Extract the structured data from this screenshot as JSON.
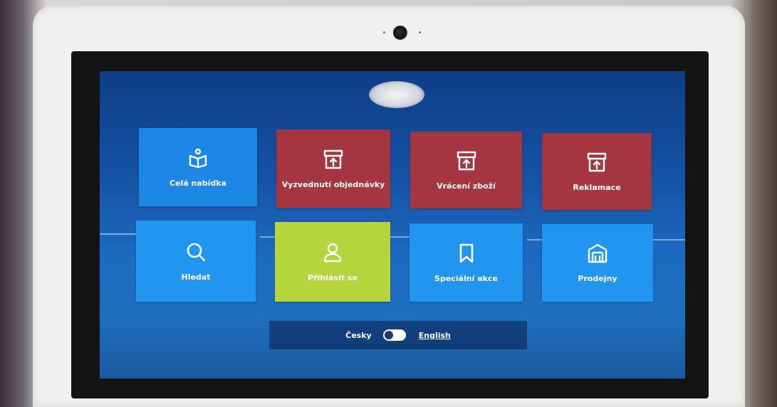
{
  "tiles": {
    "full_offer": "Celá nabídka",
    "pickup_order": "Vyzvednutí objednávky",
    "return_goods": "Vrácení zboží",
    "complaints": "Reklamace",
    "search": "Hledat",
    "login": "Přihlásit se",
    "special_offers": "Speciální akce",
    "stores": "Prodejny"
  },
  "icons": {
    "full_offer": "book-icon",
    "pickup_order": "archive-up-icon",
    "return_goods": "archive-up-icon",
    "complaints": "archive-up-icon",
    "search": "search-icon",
    "login": "user-icon",
    "special_offers": "bookmark-icon",
    "stores": "store-icon"
  },
  "language": {
    "czech": "Česky",
    "english": "English",
    "toggle_state": "czech"
  },
  "colors": {
    "blue_tile": "#1d87e6",
    "red_tile": "#a5363f",
    "green_tile": "#b6d43b"
  }
}
